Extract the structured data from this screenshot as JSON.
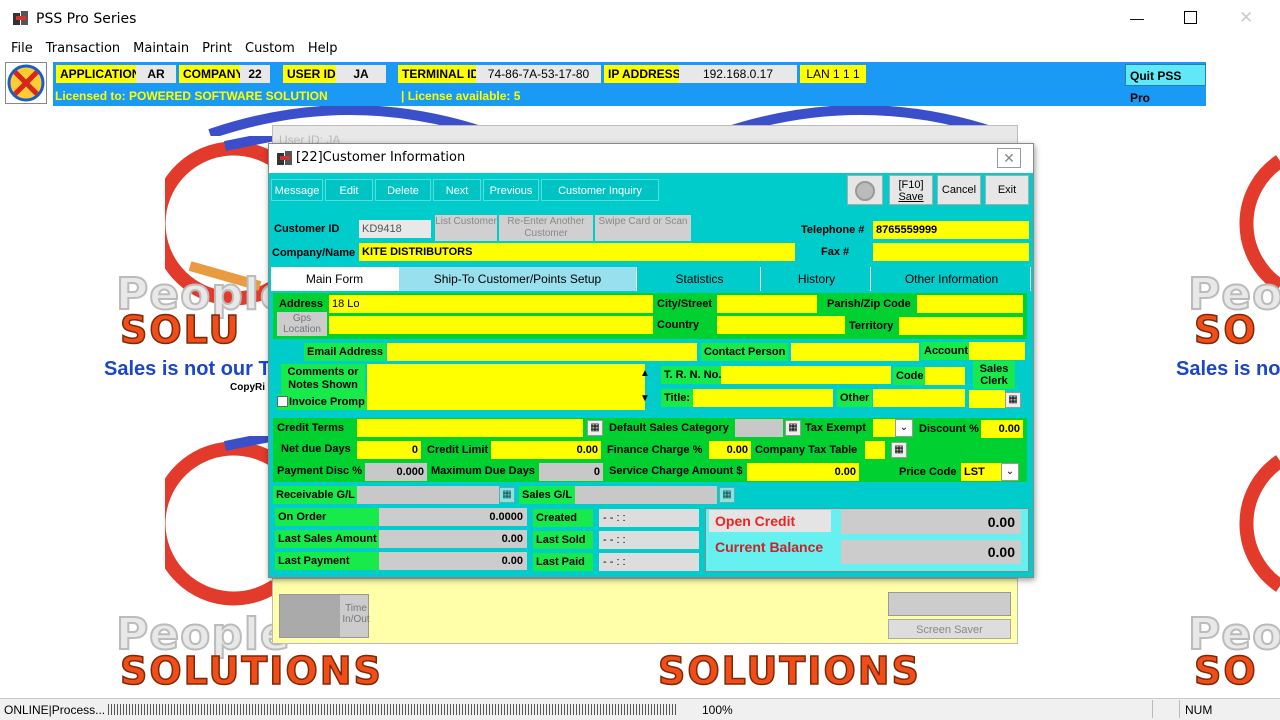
{
  "window": {
    "title": "PSS Pro Series"
  },
  "menu": [
    "File",
    "Transaction",
    "Maintain",
    "Print",
    "Custom",
    "Help"
  ],
  "infobar": {
    "application_label": "APPLICATION:",
    "application_value": "AR",
    "company_label": "COMPANY:",
    "company_value": "22",
    "userid_label": "USER ID:",
    "userid_value": "JA",
    "terminal_label": "TERMINAL ID:",
    "terminal_value": "74-86-7A-53-17-80",
    "ip_label": "IP ADDRESS:",
    "ip_value": "192.168.0.17",
    "lan": "LAN  1 1 1",
    "licensed_to": "Licensed to: POWERED SOFTWARE SOLUTION",
    "license_available": "| License available: 5",
    "quit_button": "Quit PSS Pro"
  },
  "background": {
    "people": "People",
    "solutions": "SOLUTIONS",
    "sol_short": "SOLU",
    "sol_shorter": "SO",
    "tagline": "Sales is not our Targ",
    "tagline_right": "Sales is not",
    "copyright": "CopyRi",
    "ghost_user": "User ID: JA"
  },
  "dialog": {
    "title": "[22]Customer Information",
    "toolbar": [
      "Message",
      "Edit",
      "Delete",
      "Next",
      "Previous",
      "Customer Inquiry"
    ],
    "save_label": "[F10]\nSave",
    "save_l1": "[F10]",
    "save_l2": "Save",
    "cancel_label": "Cancel",
    "exit_label": "Exit",
    "customer_id_label": "Customer ID",
    "customer_id": "KD9418",
    "list_customer": "List Customer",
    "reenter": "Re-Enter Another Customer",
    "swipe": "Swipe Card or Scan",
    "telephone_label": "Telephone #",
    "telephone": "8765559999",
    "company_name_label": "Company/Name",
    "company_name": "KITE DISTRIBUTORS",
    "fax_label": "Fax #",
    "fax": "",
    "tabs": [
      "Main Form",
      "Ship-To Customer/Points Setup",
      "Statistics",
      "History",
      "Other Information"
    ],
    "address_label": "Address",
    "address": "18 Lo",
    "gps_label": "Gps Location",
    "city_label": "City/Street",
    "parish_label": "Parish/Zip Code",
    "country_label": "Country",
    "territory_label": "Territory",
    "email_label": "Email Address",
    "contact_label": "Contact Person",
    "account_label": "Account",
    "comments_label": "Comments or Notes Shown",
    "invoice_prompt": "Invoice Promp",
    "trn_label": "T. R. N. No.",
    "code_label": "Code",
    "sales_clerk_label": "Sales Clerk",
    "title_label": "Title:",
    "other_label": "Other",
    "credit_terms_label": "Credit Terms",
    "default_sales_cat": "Default Sales Category",
    "tax_exempt": "Tax Exempt",
    "discount_label": "Discount %",
    "discount": "0.00",
    "net_due_label": "Net due Days",
    "net_due": "0",
    "credit_limit_label": "Credit Limit",
    "credit_limit": "0.00",
    "finance_label": "Finance Charge %",
    "finance": "0.00",
    "company_tax_label": "Company Tax Table",
    "payment_disc_label": "Payment Disc %",
    "payment_disc": "0.000",
    "max_due_label": "Maximum Due Days",
    "max_due": "0",
    "service_charge_label": "Service Charge Amount $",
    "service_charge": "0.00",
    "price_code_label": "Price Code",
    "price_code": "LST",
    "receivable_label": "Receivable G/L",
    "sales_gl_label": "Sales G/L",
    "on_order_label": "On Order",
    "on_order": "0.0000",
    "created_label": "Created",
    "created": "- -   : :",
    "last_sales_label": "Last Sales Amount",
    "last_sales": "0.00",
    "last_sold_label": "Last Sold",
    "last_sold": "- -   : :",
    "last_payment_label": "Last Payment",
    "last_payment": "0.00",
    "last_paid_label": "Last Paid",
    "last_paid": "- -   : :",
    "open_credit_label": "Open Credit",
    "open_credit": "0.00",
    "current_balance_label": "Current Balance",
    "current_balance": "0.00"
  },
  "lower": {
    "time_inout": "Time In/Out",
    "screen_saver": "Screen Saver"
  },
  "status": {
    "left": "ONLINE|Process...",
    "zoom": "100%",
    "num": "NUM"
  }
}
